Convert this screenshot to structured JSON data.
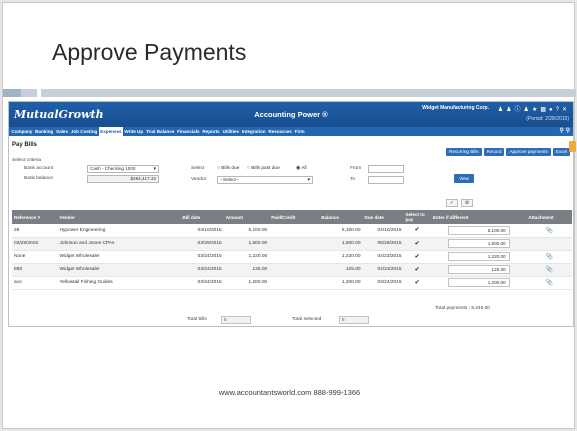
{
  "slide": {
    "title": "Approve Payments",
    "footer": "www.accountantsworld.com  888-999-1366"
  },
  "app": {
    "logo": "MutualGrowth",
    "title": "Accounting Power ®",
    "company": "Widget Manufacturing Corp.",
    "period": "(Period: 2/28/2015)",
    "menu": [
      "Company",
      "Banking",
      "Sales",
      "Job Costing",
      "Expenses",
      "Write Up",
      "Trial Balance",
      "Financials",
      "Reports",
      "Utilities",
      "Integration",
      "Resources",
      "Firm"
    ],
    "active_menu": "Expenses"
  },
  "page": {
    "title": "Pay Bills",
    "buttons": {
      "recurring": "Recurring Bills",
      "record": "Record",
      "approve": "Approve payments",
      "excel": "Excel"
    }
  },
  "criteria": {
    "heading": "Select criteria",
    "bank_account_label": "Bank account",
    "bank_account_value": "Cash - Checking 1000",
    "bank_balance_label": "Bank balance",
    "bank_balance_value": "$284,417.32",
    "select_label": "Select",
    "radio_bills_due": "Bills due",
    "radio_past_due": "Bills past due",
    "radio_all": "All",
    "vendor_label": "Vendor",
    "vendor_value": "--Select--",
    "from_label": "From",
    "to_label": "To",
    "view_button": "View"
  },
  "table": {
    "headers": {
      "reference": "Reference #",
      "vendor": "Vendor",
      "bill_date": "Bill date",
      "amount": "Amount",
      "paid_credit": "Paid/Credit",
      "balance": "Balance",
      "due_date": "Due date",
      "select": "Select to pay",
      "enter_if_different": "Enter if different",
      "attachment": "Attachment"
    },
    "rows": [
      {
        "ref": "28",
        "vendor": "Hypower Engineering",
        "bill_date": "04/10/2015",
        "amount": "5,100.00",
        "paid": "",
        "balance": "5,100.00",
        "due": "04/10/2015",
        "enter": "5,100.00",
        "clip": "📎"
      },
      {
        "ref": "03/29/2015",
        "vendor": "Johnson and Jones CPAs",
        "bill_date": "03/29/2015",
        "amount": "1,600.00",
        "paid": "",
        "balance": "1,600.00",
        "due": "05/28/2015",
        "enter": "1,600.00",
        "clip": ""
      },
      {
        "ref": "None",
        "vendor": "Widget Wholesaler",
        "bill_date": "03/24/2015",
        "amount": "1,220.00",
        "paid": "",
        "balance": "1,220.00",
        "due": "04/23/2015",
        "enter": "1,220.00",
        "clip": "📎"
      },
      {
        "ref": "tttttt",
        "vendor": "Widget Wholesaler",
        "bill_date": "03/24/2015",
        "amount": "125.00",
        "paid": "",
        "balance": "125.00",
        "due": "04/23/2015",
        "enter": "125.00",
        "clip": "📎"
      },
      {
        "ref": "ace",
        "vendor": "Yellowtail Fishing Guides",
        "bill_date": "03/24/2015",
        "amount": "1,200.00",
        "paid": "",
        "balance": "1,200.00",
        "due": "03/24/2015",
        "enter": "1,200.00",
        "clip": "📎"
      }
    ]
  },
  "totals": {
    "total_payments": "Total payments : 9,245.00",
    "total_bills_label": "Total bills",
    "total_bills_value": "5",
    "total_selected_label": "Total selected",
    "total_selected_value": "5"
  }
}
